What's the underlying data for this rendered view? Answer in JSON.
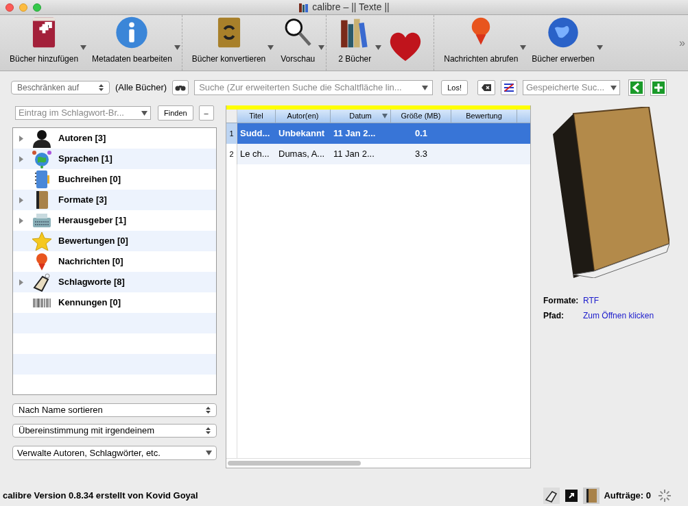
{
  "window": {
    "title": "calibre – || Texte ||"
  },
  "toolbar": {
    "groups": [
      [
        {
          "kind": "add",
          "label": "Bücher hinzufügen",
          "menu": true
        },
        {
          "kind": "info",
          "label": "Metadaten bearbeiten",
          "menu": true
        }
      ],
      [
        {
          "kind": "convert",
          "label": "Bücher konvertieren",
          "menu": true
        },
        {
          "kind": "preview",
          "label": "Vorschau",
          "menu": true
        }
      ],
      [
        {
          "kind": "library",
          "label": "2 Bücher",
          "menu": true
        },
        {
          "kind": "heart",
          "menu": false
        }
      ],
      [
        {
          "kind": "news",
          "label": "Nachrichten abrufen",
          "menu": true
        },
        {
          "kind": "globe",
          "label": "Bücher erwerben",
          "menu": true
        }
      ]
    ],
    "overflow": "»"
  },
  "search_bar": {
    "restrict": "Beschränken auf",
    "restrict_label": "(Alle Bücher)",
    "search_placeholder": "Suche (Zur erweiterten Suche die Schaltfläche lin...",
    "go": "Los!",
    "saved_placeholder": "Gespeicherte Suc..."
  },
  "tag_browser": {
    "find_placeholder": "Eintrag im Schlagwort-Br...",
    "find": "Finden",
    "collapse": "–",
    "items": [
      {
        "kind": "person",
        "label": "Autoren [3]",
        "expandable": true
      },
      {
        "kind": "languages",
        "label": "Sprachen [1]",
        "expandable": true
      },
      {
        "kind": "series",
        "label": "Buchreihen [0]",
        "expandable": false
      },
      {
        "kind": "formats",
        "label": "Formate [3]",
        "expandable": true
      },
      {
        "kind": "publisher",
        "label": "Herausgeber [1]",
        "expandable": true
      },
      {
        "kind": "rating",
        "label": "Bewertungen [0]",
        "expandable": false
      },
      {
        "kind": "news",
        "label": "Nachrichten [0]",
        "expandable": false
      },
      {
        "kind": "tags",
        "label": "Schlagworte [8]",
        "expandable": true
      },
      {
        "kind": "ids",
        "label": "Kennungen [0]",
        "expandable": false
      }
    ],
    "sort": "Nach Name sortieren",
    "match": "Übereinstimmung mit irgendeinem",
    "manage": "Verwalte Autoren, Schlagwörter, etc."
  },
  "table": {
    "columns": [
      {
        "label": "Titel",
        "sorted": false
      },
      {
        "label": "Autor(en)",
        "sorted": false
      },
      {
        "label": "Datum",
        "sorted": true
      },
      {
        "label": "Größe (MB)",
        "sorted": false
      },
      {
        "label": "Bewertung",
        "sorted": false
      }
    ],
    "rows": [
      {
        "number": "1",
        "selected": true,
        "cells": [
          "Sudd...",
          "Unbekannt",
          "11 Jan 2...",
          "0.1"
        ]
      },
      {
        "number": "2",
        "selected": false,
        "cells": [
          "Le ch...",
          "Dumas, A...",
          "11 Jan 2...",
          "3.3"
        ]
      }
    ]
  },
  "details": {
    "fields": [
      {
        "label": "Formate:",
        "value": "RTF"
      },
      {
        "label": "Pfad:",
        "value": "Zum Öffnen klicken"
      }
    ]
  },
  "status_bar": {
    "text": "calibre Version 0.8.34 erstellt von Kovid Goyal",
    "jobs": "Aufträge: 0"
  }
}
